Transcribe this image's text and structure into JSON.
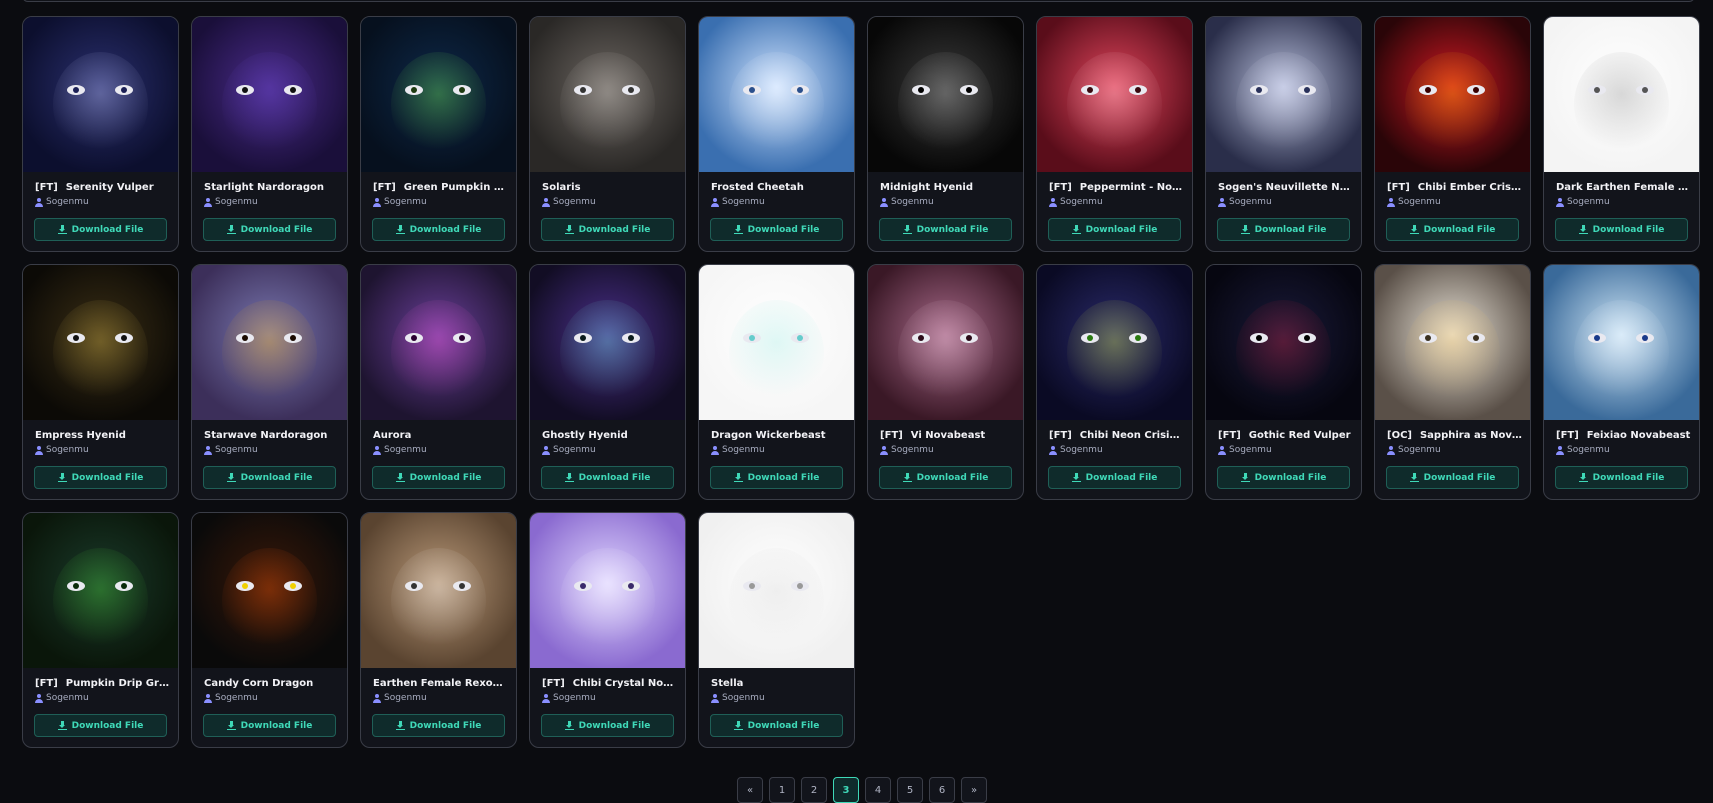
{
  "items": [
    {
      "tag": "[FT]",
      "name": "Serenity Vulper",
      "author": "Sogenmu",
      "button": "Download File",
      "bg": [
        "#0c0f2e",
        "#2a2f6e"
      ],
      "accent": "#c9cfff",
      "pupil": "#1b1f55"
    },
    {
      "tag": "",
      "name": "Starlight Nardoragon",
      "author": "Sogenmu",
      "button": "Download File",
      "bg": [
        "#1a0f3a",
        "#4a2b8a"
      ],
      "accent": "#6b4bd0",
      "pupil": "#111"
    },
    {
      "tag": "[FT]",
      "name": "Green Pumpkin Dri...",
      "author": "Sogenmu",
      "button": "Download File",
      "bg": [
        "#06101e",
        "#0d2848"
      ],
      "accent": "#7dff4f",
      "pupil": "#1d3a10"
    },
    {
      "tag": "",
      "name": "Solaris",
      "author": "Sogenmu",
      "button": "Download File",
      "bg": [
        "#2a2826",
        "#6b6560"
      ],
      "accent": "#d8d4cf",
      "pupil": "#333"
    },
    {
      "tag": "",
      "name": "Frosted Cheetah",
      "author": "Sogenmu",
      "button": "Download File",
      "bg": [
        "#3a6fb0",
        "#cfe3ff"
      ],
      "accent": "#ffffff",
      "pupil": "#2a4f8c"
    },
    {
      "tag": "",
      "name": "Midnight Hyenid",
      "author": "Sogenmu",
      "button": "Download File",
      "bg": [
        "#070707",
        "#3a3a3a"
      ],
      "accent": "#bdbdbd",
      "pupil": "#000"
    },
    {
      "tag": "[FT]",
      "name": "Peppermint - Nova...",
      "author": "Sogenmu",
      "button": "Download File",
      "bg": [
        "#5a0d1a",
        "#e0455c"
      ],
      "accent": "#ffd7de",
      "pupil": "#3b0a10"
    },
    {
      "tag": "",
      "name": "Sogen's Neuvillette Nova...",
      "author": "Sogenmu",
      "button": "Download File",
      "bg": [
        "#2a2e4a",
        "#b8bfdc"
      ],
      "accent": "#eef0ff",
      "pupil": "#29315a"
    },
    {
      "tag": "[FT]",
      "name": "Chibi Ember Crisis ...",
      "author": "Sogenmu",
      "button": "Download File",
      "bg": [
        "#2a0508",
        "#d01822"
      ],
      "accent": "#ffc400",
      "pupil": "#3a0000"
    },
    {
      "tag": "",
      "name": "Dark Earthen Female Rex...",
      "author": "Sogenmu",
      "button": "Download File",
      "bg": [
        "#f4f4f4",
        "#ffffff"
      ],
      "accent": "#8a8a8a",
      "pupil": "#555"
    },
    {
      "tag": "",
      "name": "Empress Hyenid",
      "author": "Sogenmu",
      "button": "Download File",
      "bg": [
        "#0c0a06",
        "#3a2e14"
      ],
      "accent": "#e0c050",
      "pupil": "#111"
    },
    {
      "tag": "",
      "name": "Starwave Nardoragon",
      "author": "Sogenmu",
      "button": "Download File",
      "bg": [
        "#3c2f5a",
        "#7a78b0"
      ],
      "accent": "#ffb400",
      "pupil": "#1a0a00"
    },
    {
      "tag": "",
      "name": "Aurora",
      "author": "Sogenmu",
      "button": "Download File",
      "bg": [
        "#1e1430",
        "#6a3f9a"
      ],
      "accent": "#ff5ad8",
      "pupil": "#2a0030"
    },
    {
      "tag": "",
      "name": "Ghostly Hyenid",
      "author": "Sogenmu",
      "button": "Download File",
      "bg": [
        "#120d24",
        "#4a2f8a"
      ],
      "accent": "#6ff0e0",
      "pupil": "#0a1a1a"
    },
    {
      "tag": "",
      "name": "Dragon Wickerbeast",
      "author": "Sogenmu",
      "button": "Download File",
      "bg": [
        "#f6f6f6",
        "#ffffff"
      ],
      "accent": "#9ee8e0",
      "pupil": "#6cc"
    },
    {
      "tag": "[FT]",
      "name": "Vi Novabeast",
      "author": "Sogenmu",
      "button": "Download File",
      "bg": [
        "#3a1826",
        "#a86a8a"
      ],
      "accent": "#f0d0e0",
      "pupil": "#2a0a18"
    },
    {
      "tag": "[FT]",
      "name": "Chibi Neon Crisis N...",
      "author": "Sogenmu",
      "button": "Download File",
      "bg": [
        "#0a0a24",
        "#2a2a6a"
      ],
      "accent": "#e8ff40",
      "pupil": "#2a7a10"
    },
    {
      "tag": "[FT]",
      "name": "Gothic Red Vulper",
      "author": "Sogenmu",
      "button": "Download File",
      "bg": [
        "#060610",
        "#1a1a3a"
      ],
      "accent": "#d0203a",
      "pupil": "#000"
    },
    {
      "tag": "[OC]",
      "name": "Sapphira as Nova...",
      "author": "Sogenmu",
      "button": "Download File",
      "bg": [
        "#5a5048",
        "#e8e2d6"
      ],
      "accent": "#f0c060",
      "pupil": "#3a3020"
    },
    {
      "tag": "[FT]",
      "name": "Feixiao Novabeast",
      "author": "Sogenmu",
      "button": "Download File",
      "bg": [
        "#3a6a9a",
        "#cfe6f6"
      ],
      "accent": "#f4f8ff",
      "pupil": "#1a3a8a"
    },
    {
      "tag": "[FT]",
      "name": "Pumpkin Drip Gree...",
      "author": "Sogenmu",
      "button": "Download File",
      "bg": [
        "#0a160a",
        "#1a3a2a"
      ],
      "accent": "#4fdc3a",
      "pupil": "#0a2a0a"
    },
    {
      "tag": "",
      "name": "Candy Corn Dragon",
      "author": "Sogenmu",
      "button": "Download File",
      "bg": [
        "#0a0a0a",
        "#3a1808"
      ],
      "accent": "#ff5a0a",
      "pupil": "#f0d000"
    },
    {
      "tag": "",
      "name": "Earthen Female Rexouium",
      "author": "Sogenmu",
      "button": "Download File",
      "bg": [
        "#5a4430",
        "#b89878"
      ],
      "accent": "#f2f2f2",
      "pupil": "#333"
    },
    {
      "tag": "[FT]",
      "name": "Chibi Crystal Nova...",
      "author": "Sogenmu",
      "button": "Download File",
      "bg": [
        "#8a6ad0",
        "#e0d6ff"
      ],
      "accent": "#ffffff",
      "pupil": "#3a2a6a"
    },
    {
      "tag": "",
      "name": "Stella",
      "author": "Sogenmu",
      "button": "Download File",
      "bg": [
        "#f0f0f0",
        "#ffffff"
      ],
      "accent": "#d0d0d0",
      "pupil": "#999"
    }
  ],
  "pagination": {
    "prev": "«",
    "pages": [
      "1",
      "2",
      "3",
      "4",
      "5",
      "6"
    ],
    "current": "3",
    "next": "»"
  }
}
